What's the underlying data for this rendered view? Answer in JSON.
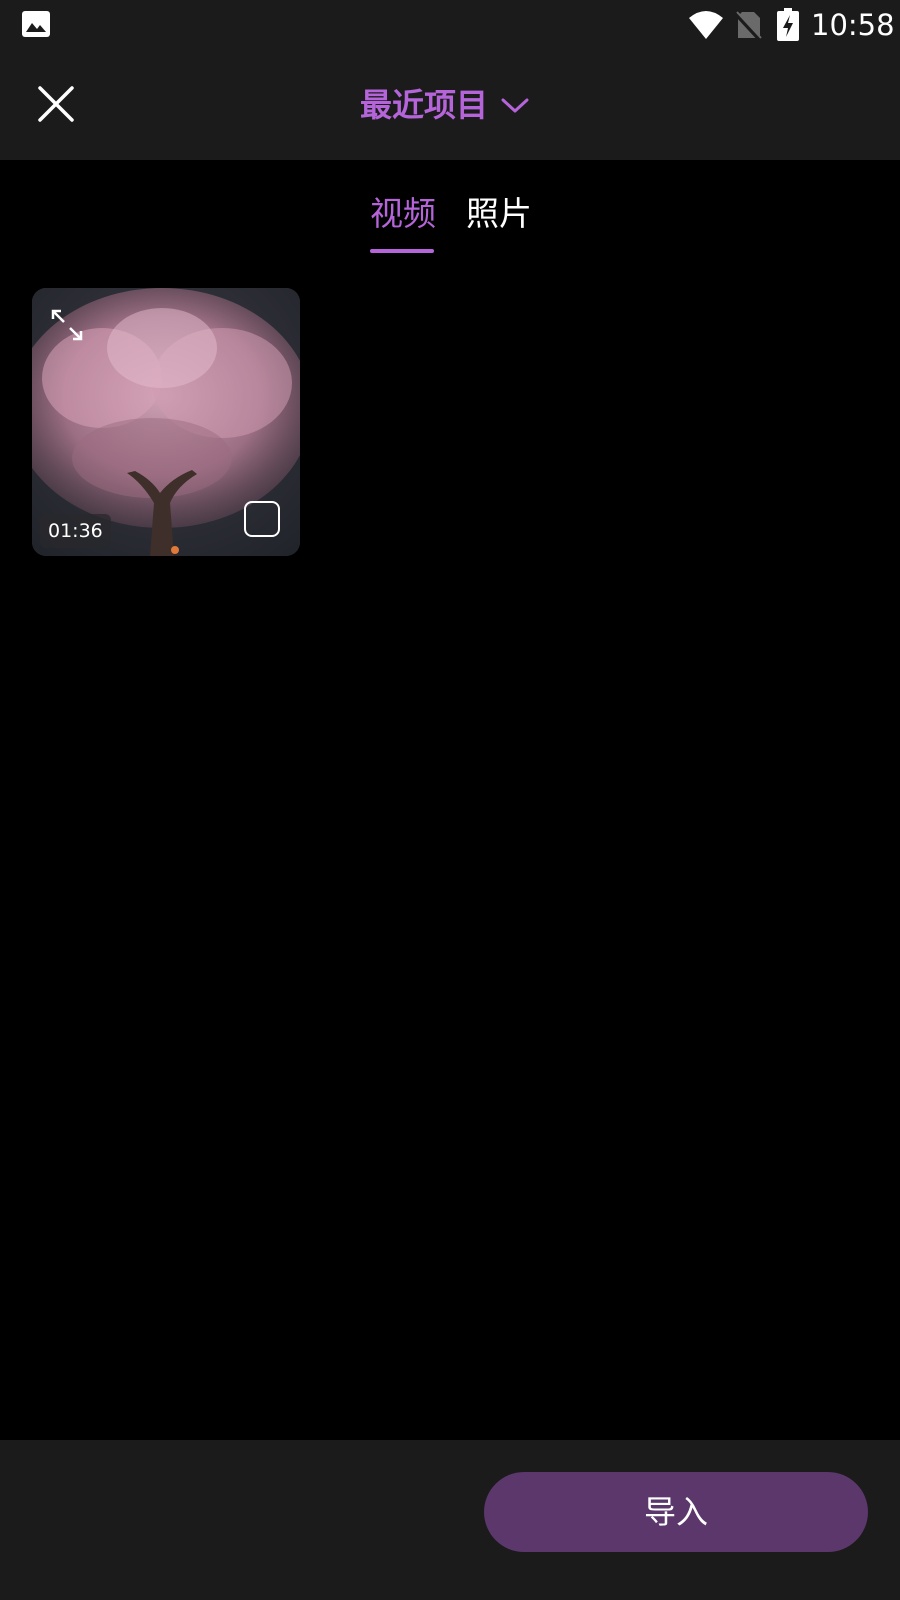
{
  "status_bar": {
    "time": "10:58",
    "icons": [
      "gallery-icon",
      "wifi-icon",
      "no-sim-icon",
      "battery-charging-icon"
    ]
  },
  "header": {
    "title": "最近项目",
    "close_icon": "close-icon",
    "dropdown_icon": "chevron-down-icon"
  },
  "tabs": [
    {
      "label": "视频",
      "active": true
    },
    {
      "label": "照片",
      "active": false
    }
  ],
  "media": [
    {
      "type": "video",
      "duration": "01:36",
      "selected": false,
      "thumbnail": "cherry blossom tree at night"
    }
  ],
  "footer": {
    "import_label": "导入"
  },
  "colors": {
    "accent": "#b565d9",
    "import_button": "#5b376b",
    "bar_background": "#1b1b1b",
    "background": "#000000"
  }
}
